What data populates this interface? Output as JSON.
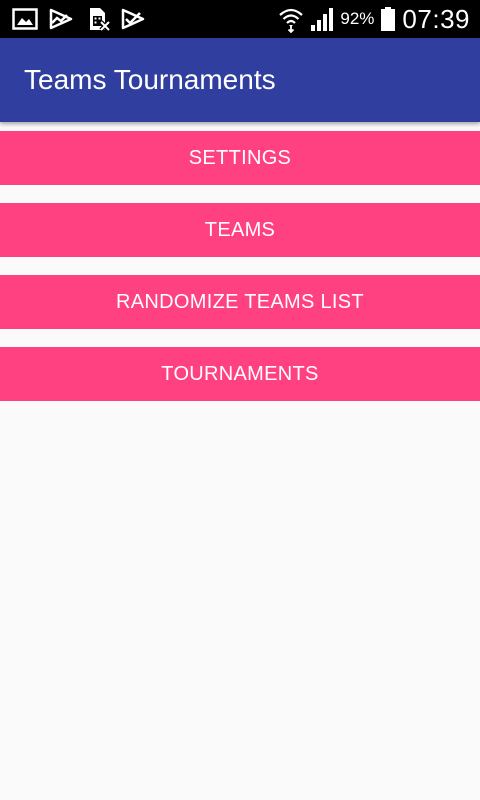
{
  "status_bar": {
    "left_icons": [
      "image-icon",
      "trending-icon",
      "sim-card-error-icon",
      "checkbox-icon"
    ],
    "right_icons": [
      "wifi-icon",
      "cell-signal-icon",
      "battery-icon"
    ],
    "battery": "92%",
    "time": "07:39"
  },
  "app_bar": {
    "title": "Teams Tournaments",
    "color": "#303f9f"
  },
  "menu": {
    "button_color": "#ff4081",
    "items": [
      {
        "label": "SETTINGS"
      },
      {
        "label": "TEAMS"
      },
      {
        "label": "RANDOMIZE TEAMS LIST"
      },
      {
        "label": "TOURNAMENTS"
      }
    ]
  }
}
